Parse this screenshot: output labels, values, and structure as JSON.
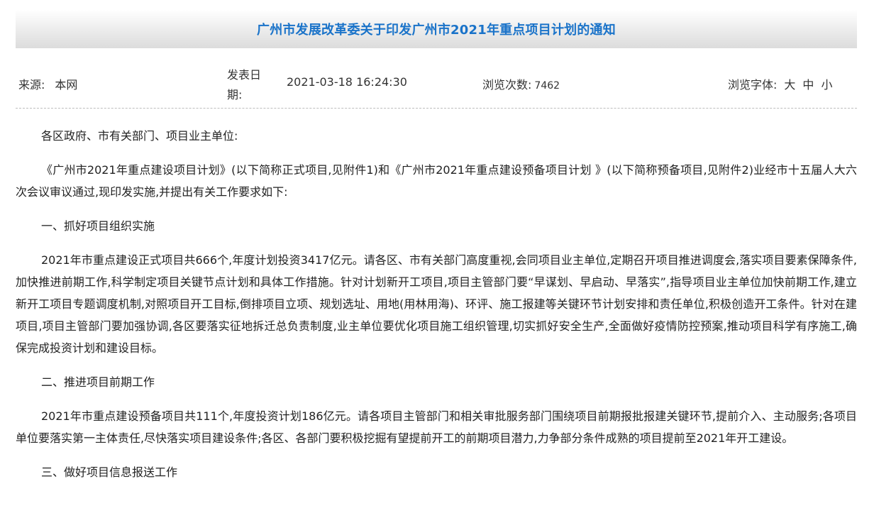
{
  "article": {
    "title": "广州市发展改革委关于印发广州市2021年重点项目计划的通知"
  },
  "meta": {
    "source_label": "来源:",
    "source_value": "本网",
    "date_label": "发表日期:",
    "date_value": "2021-03-18 16:24:30",
    "views_label": "浏览次数:",
    "views_count": "7462",
    "font_label": "浏览字体:",
    "font_large": "大",
    "font_medium": "中",
    "font_small": "小"
  },
  "content": {
    "paragraphs": [
      "各区政府、市有关部门、项目业主单位:",
      "《广州市2021年重点建设项目计划》(以下简称正式项目,见附件1)和《广州市2021年重点建设预备项目计划 》(以下简称预备项目,见附件2)业经市十五届人大六次会议审议通过,现印发实施,并提出有关工作要求如下:",
      "一、抓好项目组织实施",
      "2021年市重点建设正式项目共666个,年度计划投资3417亿元。请各区、市有关部门高度重视,会同项目业主单位,定期召开项目推进调度会,落实项目要素保障条件,加快推进前期工作,科学制定项目关键节点计划和具体工作措施。针对计划新开工项目,项目主管部门要“早谋划、早启动、早落实”,指导项目业主单位加快前期工作,建立新开工项目专题调度机制,对照项目开工目标,倒排项目立项、规划选址、用地(用林用海)、环评、施工报建等关键环节计划安排和责任单位,积极创造开工条件。针对在建项目,项目主管部门要加强协调,各区要落实征地拆迁总负责制度,业主单位要优化项目施工组织管理,切实抓好安全生产,全面做好疫情防控预案,推动项目科学有序施工,确保完成投资计划和建设目标。",
      "二、推进项目前期工作",
      "2021年市重点建设预备项目共111个,年度投资计划186亿元。请各项目主管部门和相关审批服务部门围绕项目前期报批报建关键环节,提前介入、主动服务;各项目单位要落实第一主体责任,尽快落实项目建设条件;各区、各部门要积极挖掘有望提前开工的前期项目潜力,力争部分条件成熟的项目提前至2021年开工建设。",
      "三、做好项目信息报送工作"
    ]
  }
}
